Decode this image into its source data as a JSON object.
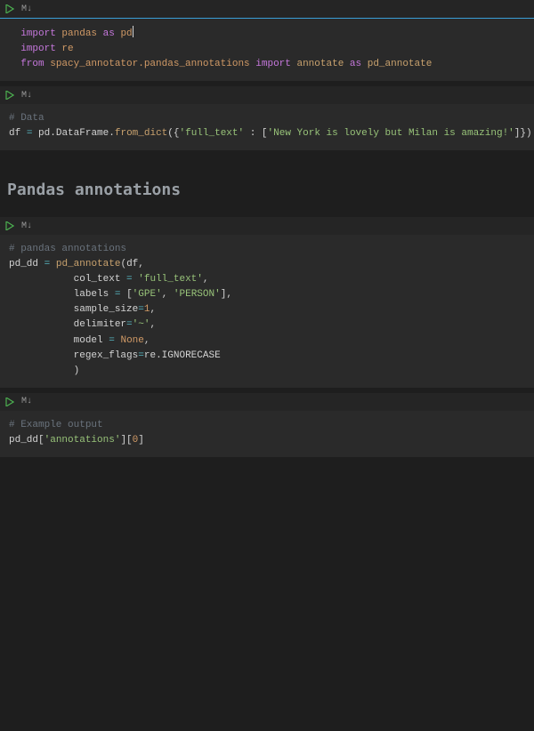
{
  "toolbar": {
    "md_label": "M↓"
  },
  "cell1": {
    "kw_import1": "import",
    "lib_pandas": "pandas",
    "kw_as1": "as",
    "alias_pd": "pd",
    "kw_import2": "import",
    "lib_re": "re",
    "kw_from": "from",
    "lib_spacy": "spacy_annotator.pandas_annotations",
    "kw_import3": "import",
    "fn_annotate": "annotate",
    "kw_as2": "as",
    "alias_pda": "pd_annotate"
  },
  "cell2": {
    "cmt": "# Data",
    "var_df": "df",
    "eq": "=",
    "pd": "pd",
    "dot1": ".",
    "dframe": "DataFrame",
    "dot2": ".",
    "fromdict": "from_dict",
    "lparen": "({",
    "key": "'full_text'",
    "colon": " : [",
    "val": "'New York is lovely but Milan is amazing!'",
    "rparen": "]})"
  },
  "heading": "Pandas annotations",
  "cell3": {
    "cmt": "# pandas annotations",
    "lhs": "pd_dd",
    "eq": "=",
    "fn": "pd_annotate",
    "arg_df": "df",
    "p_coltext": "col_text",
    "v_coltext": "'full_text'",
    "p_labels": "labels",
    "v_labels_open": "[",
    "v_label1": "'GPE'",
    "v_label2": "'PERSON'",
    "v_labels_close": "]",
    "p_sample": "sample_size",
    "v_sample": "1",
    "p_delim": "delimiter",
    "v_delim": "'~'",
    "p_model": "model",
    "v_model": "None",
    "p_regex": "regex_flags",
    "v_regex_re": "re",
    "v_regex_dot": ".",
    "v_regex_ic": "IGNORECASE",
    "close": ")"
  },
  "cell4": {
    "cmt": "# Example output",
    "var": "pd_dd",
    "lbr": "[",
    "key": "'annotations'",
    "rbr": "][",
    "idx": "0",
    "rbr2": "]"
  }
}
